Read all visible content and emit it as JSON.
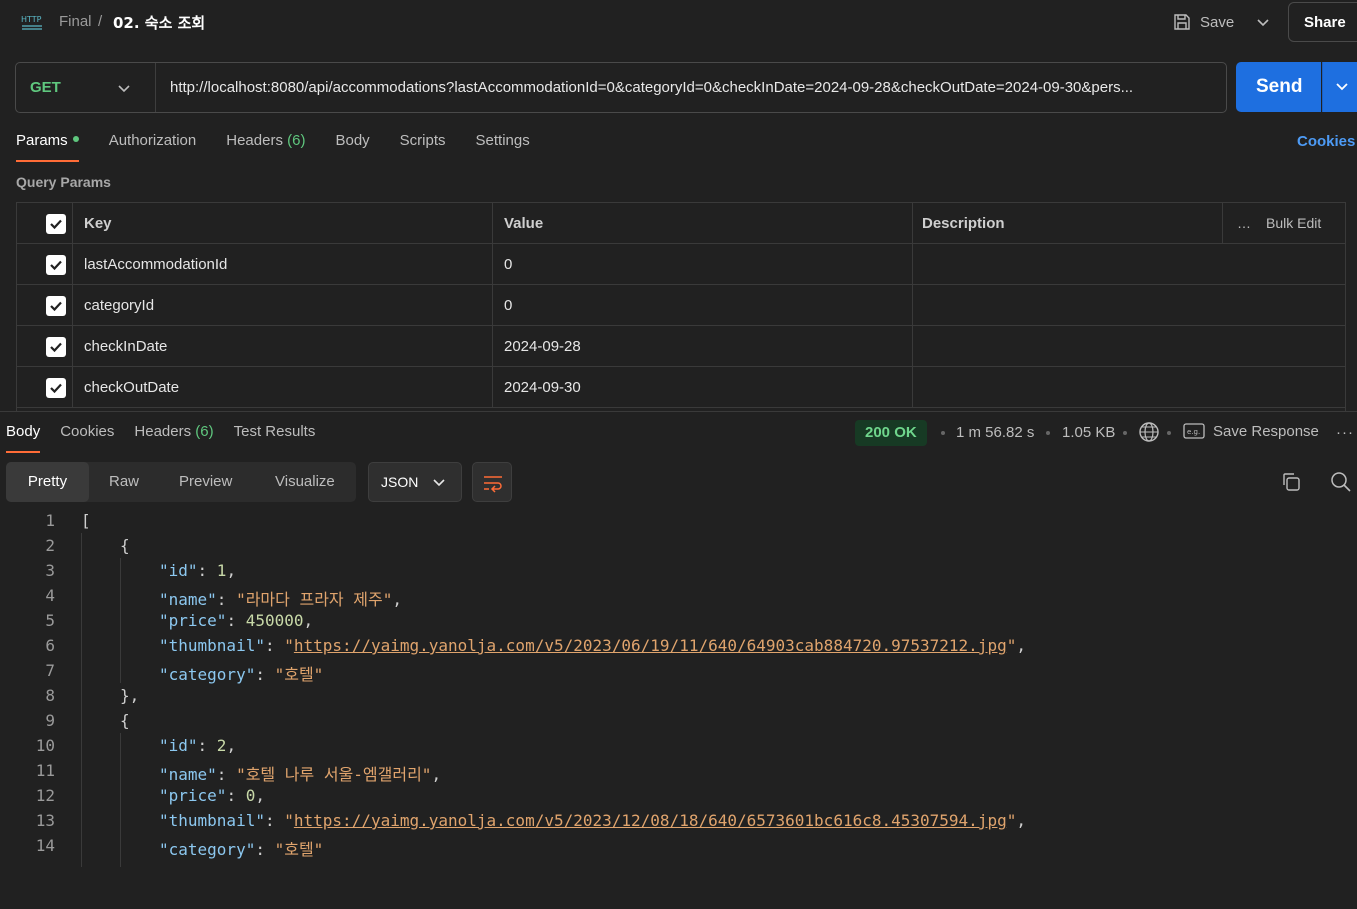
{
  "header": {
    "icon": "http-icon",
    "breadcrumb_parent": "Final",
    "breadcrumb_sep": "/",
    "title": "02. 숙소 조회",
    "save_label": "Save",
    "share_label": "Share"
  },
  "request": {
    "method": "GET",
    "url": "http://localhost:8080/api/accommodations?lastAccommodationId=0&categoryId=0&checkInDate=2024-09-28&checkOutDate=2024-09-30&pers...",
    "send_label": "Send"
  },
  "request_tabs": {
    "params": "Params",
    "authorization": "Authorization",
    "headers": "Headers",
    "headers_count": "(6)",
    "body": "Body",
    "scripts": "Scripts",
    "settings": "Settings",
    "cookies": "Cookies"
  },
  "query_params": {
    "title": "Query Params",
    "columns": {
      "key": "Key",
      "value": "Value",
      "description": "Description",
      "bulk_edit": "Bulk Edit"
    },
    "rows": [
      {
        "key": "lastAccommodationId",
        "value": "0"
      },
      {
        "key": "categoryId",
        "value": "0"
      },
      {
        "key": "checkInDate",
        "value": "2024-09-28"
      },
      {
        "key": "checkOutDate",
        "value": "2024-09-30"
      }
    ]
  },
  "response_tabs": {
    "body": "Body",
    "cookies": "Cookies",
    "headers": "Headers",
    "headers_count": "(6)",
    "test_results": "Test Results"
  },
  "response_meta": {
    "status": "200 OK",
    "time": "1 m 56.82 s",
    "size": "1.05 KB",
    "save_response": "Save Response",
    "status_color": "#6fd68c"
  },
  "view": {
    "pretty": "Pretty",
    "raw": "Raw",
    "preview": "Preview",
    "visualize": "Visualize",
    "format": "JSON"
  },
  "code_lines": {
    "n1": "1",
    "n2": "2",
    "n3": "3",
    "n4": "4",
    "n5": "5",
    "n6": "6",
    "n7": "7",
    "n8": "8",
    "n9": "9",
    "n10": "10",
    "n11": "11",
    "n12": "12",
    "n13": "13",
    "n14": "14",
    "open_bracket": "[",
    "open_brace": "{",
    "close_brace_comma": "},",
    "item1": {
      "id": "1",
      "name": "\"라마다 프라자 제주\"",
      "price": "450000",
      "thumbnail": "https://yaimg.yanolja.com/v5/2023/06/19/11/640/64903cab884720.97537212.jpg",
      "category": "\"호텔\""
    },
    "item2": {
      "id": "2",
      "name": "\"호텔 나루 서울-엠갤러리\"",
      "price": "0",
      "thumbnail": "https://yaimg.yanolja.com/v5/2023/12/08/18/640/6573601bc616c8.45307594.jpg",
      "category": "\"호텔\""
    },
    "keys": {
      "id": "\"id\"",
      "name": "\"name\"",
      "price": "\"price\"",
      "thumbnail": "\"thumbnail\"",
      "category": "\"category\""
    }
  },
  "colors": {
    "accent_tab": "#ff6c37",
    "send_button": "#1e6fe0",
    "method_get": "#5fc77e",
    "link": "#4d9bf5"
  }
}
